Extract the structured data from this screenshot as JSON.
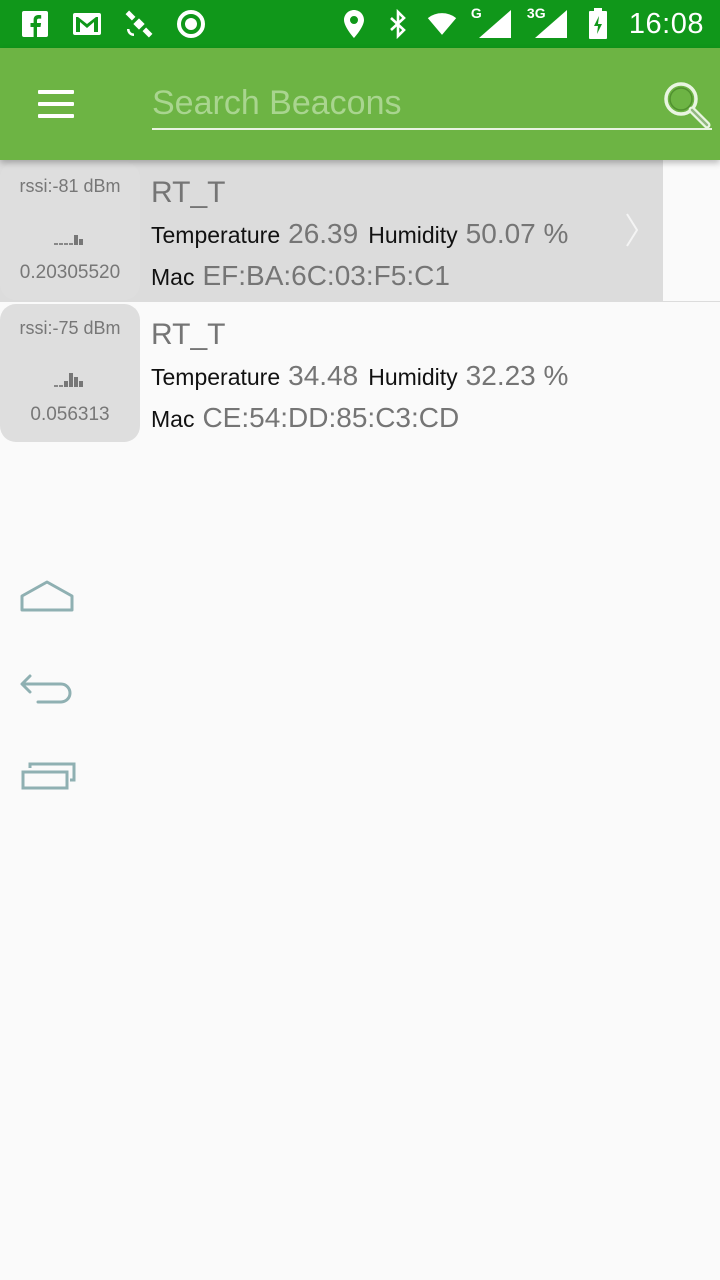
{
  "status_bar": {
    "time": "16:08",
    "network_tag_1": "G",
    "network_tag_2": "3G",
    "left_icons": [
      "facebook-icon",
      "gmail-icon",
      "satellite-icon",
      "sync-icon"
    ],
    "right_icons": [
      "location-icon",
      "bluetooth-icon",
      "wifi-icon",
      "signal-icon",
      "signal-icon",
      "battery-charging-icon"
    ]
  },
  "toolbar": {
    "search_placeholder": "Search Beacons",
    "colors": {
      "status_bar": "#10971a",
      "toolbar": "#6db444"
    }
  },
  "beacons": [
    {
      "rssi": "rssi:-81 dBm",
      "distance": "0.20305520",
      "name": "RT_T",
      "temperature_label": "Temperature",
      "temperature": "26.39",
      "humidity_label": "Humidity",
      "humidity": "50.07 %",
      "mac_label": "Mac",
      "mac": "EF:BA:6C:03:F5:C1",
      "selected": true
    },
    {
      "rssi": "rssi:-75 dBm",
      "distance": "0.056313",
      "name": "RT_T",
      "temperature_label": "Temperature",
      "temperature": "34.48",
      "humidity_label": "Humidity",
      "humidity": "32.23 %",
      "mac_label": "Mac",
      "mac": "CE:54:DD:85:C3:CD",
      "selected": false
    }
  ],
  "nav_buttons": [
    "home-icon",
    "back-icon",
    "recents-icon"
  ]
}
